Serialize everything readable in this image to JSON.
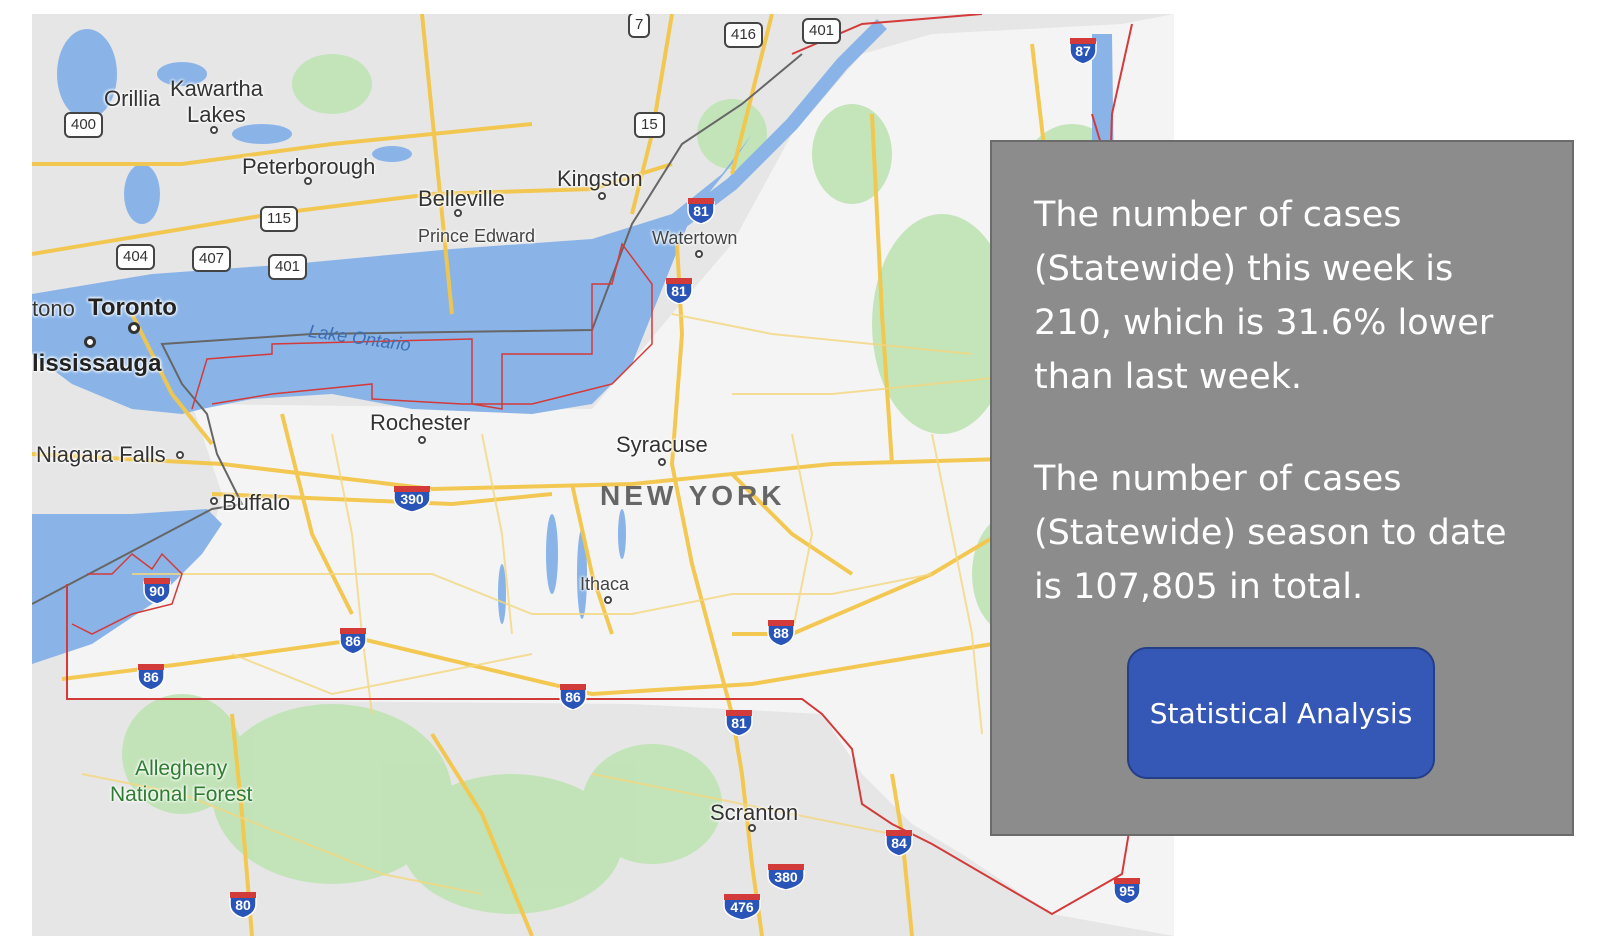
{
  "map": {
    "cities": {
      "orillia": "Orillia",
      "kawartha": "Kawartha",
      "kawartha_lakes": "Lakes",
      "peterborough": "Peterborough",
      "belleville": "Belleville",
      "kingston": "Kingston",
      "prince_edward": "Prince Edward",
      "watertown": "Watertown",
      "toronto_left": "tono",
      "toronto": "Toronto",
      "mississauga": "lississauga",
      "niagara_falls": "Niagara Falls",
      "rochester": "Rochester",
      "syracuse": "Syracuse",
      "buffalo": "Buffalo",
      "ithaca": "Ithaca",
      "scranton": "Scranton"
    },
    "state_label": "NEW YORK",
    "lake_label": "Lake Ontario",
    "park_label_line1": "Allegheny",
    "park_label_line2": "National Forest",
    "routes": {
      "r7": "7",
      "r416": "416",
      "r401a": "401",
      "r400": "400",
      "r15": "15",
      "r115": "115",
      "r404": "404",
      "r407": "407",
      "r401b": "401"
    },
    "interstates": {
      "i87": "87",
      "i81a": "81",
      "i81b": "81",
      "i390": "390",
      "i90": "90",
      "i86a": "86",
      "i86b": "86",
      "i86c": "86",
      "i88": "88",
      "i81c": "81",
      "i84": "84",
      "i380": "380",
      "i80": "80",
      "i476": "476",
      "i95": "95"
    }
  },
  "panel": {
    "weekly_text": "The number of cases (Statewide) this week is 210, which is 31.6% lower than last week.",
    "season_text": "The number of cases (Statewide) season to date is 107,805 in total.",
    "button_label": "Statistical Analysis"
  },
  "colors": {
    "water": "#8ab4e8",
    "land": "#f2f2f2",
    "highway": "#f3c64a",
    "state_border": "#d33a3a",
    "panel_bg": "#8c8c8c",
    "button_bg": "#3557b5"
  }
}
